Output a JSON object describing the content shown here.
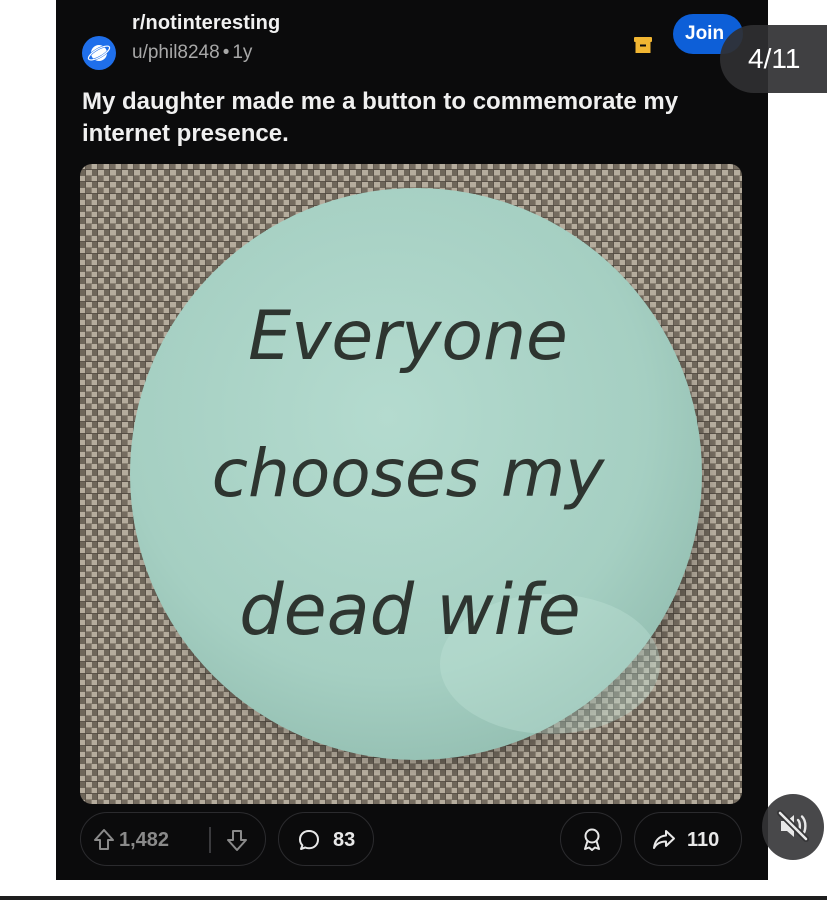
{
  "post": {
    "subreddit": "r/notinteresting",
    "author": "u/phil8248",
    "age": "1y",
    "join_label": "Join",
    "title": "My daughter made me a button to commemorate my internet presence.",
    "image": {
      "button_text": [
        "Everyone",
        "chooses my",
        "dead wife"
      ],
      "button_color": "#a9d3c6",
      "fabric_color": "#8e8577"
    },
    "actions": {
      "upvotes": "1,482",
      "comments": "83",
      "shares": "110"
    }
  },
  "gallery": {
    "counter": "4/11"
  },
  "icons": {
    "subreddit_avatar": "planet-icon",
    "archive": "archive-icon",
    "upvote": "upvote-arrow-icon",
    "downvote": "downvote-arrow-icon",
    "comment": "comment-bubble-icon",
    "award": "award-icon",
    "share": "share-arrow-icon",
    "mute": "speaker-muted-icon"
  },
  "colors": {
    "card_background": "#0b0b0c",
    "join_button": "#0d5fd8",
    "archive_icon": "#f2b632"
  }
}
